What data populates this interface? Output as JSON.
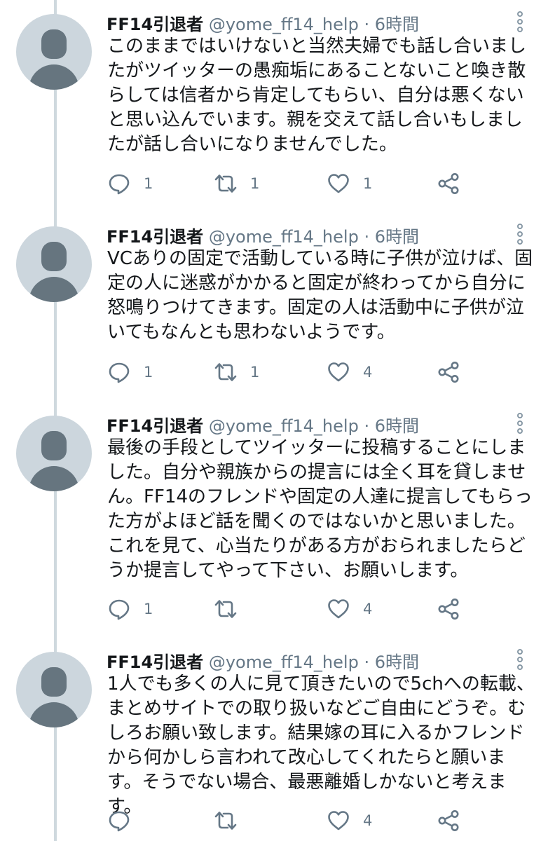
{
  "colors": {
    "avatar_bg": "#ccd6dd",
    "avatar_fg": "#66757f",
    "thread_line": "#cfd9de",
    "secondary_text": "#657786",
    "icon": "#657786"
  },
  "icons": {
    "reply": "reply-icon",
    "retweet": "retweet-icon",
    "like": "heart-icon",
    "share": "share-icon",
    "more": "more-options-icon"
  },
  "tweets": [
    {
      "name": "FF14引退者",
      "handle": "@yome_ff14_help",
      "separator": "·",
      "time": "6時間",
      "text": "このままではいけないと当然夫婦でも話し合いましたがツイッターの愚痴垢にあることないこと喚き散らしては信者から肯定してもらい、自分は悪くないと思い込んでいます。親を交えて話し合いもしましたが話し合いになりませんでした。",
      "replies": "1",
      "retweets": "1",
      "likes": "1"
    },
    {
      "name": "FF14引退者",
      "handle": "@yome_ff14_help",
      "separator": "·",
      "time": "6時間",
      "text": "VCありの固定で活動している時に子供が泣けば、固定の人に迷惑がかかると固定が終わってから自分に怒鳴りつけてきます。固定の人は活動中に子供が泣いてもなんとも思わないようです。",
      "replies": "1",
      "retweets": "1",
      "likes": "4"
    },
    {
      "name": "FF14引退者",
      "handle": "@yome_ff14_help",
      "separator": "·",
      "time": "6時間",
      "text": "最後の手段としてツイッターに投稿することにしました。自分や親族からの提言には全く耳を貸しません。FF14のフレンドや固定の人達に提言してもらった方がよほど話を聞くのではないかと思いました。これを見て、心当たりがある方がおられましたらどうか提言してやって下さい、お願いします。",
      "replies": "1",
      "retweets": "",
      "likes": "4"
    },
    {
      "name": "FF14引退者",
      "handle": "@yome_ff14_help",
      "separator": "·",
      "time": "6時間",
      "text": "1人でも多くの人に見て頂きたいので5chへの転載、まとめサイトでの取り扱いなどご自由にどうぞ。むしろお願い致します。結果嫁の耳に入るかフレンドから何かしら言われて改心してくれたらと願います。そうでない場合、最悪離婚しかないと考えます。",
      "replies": "",
      "retweets": "",
      "likes": "4"
    }
  ]
}
